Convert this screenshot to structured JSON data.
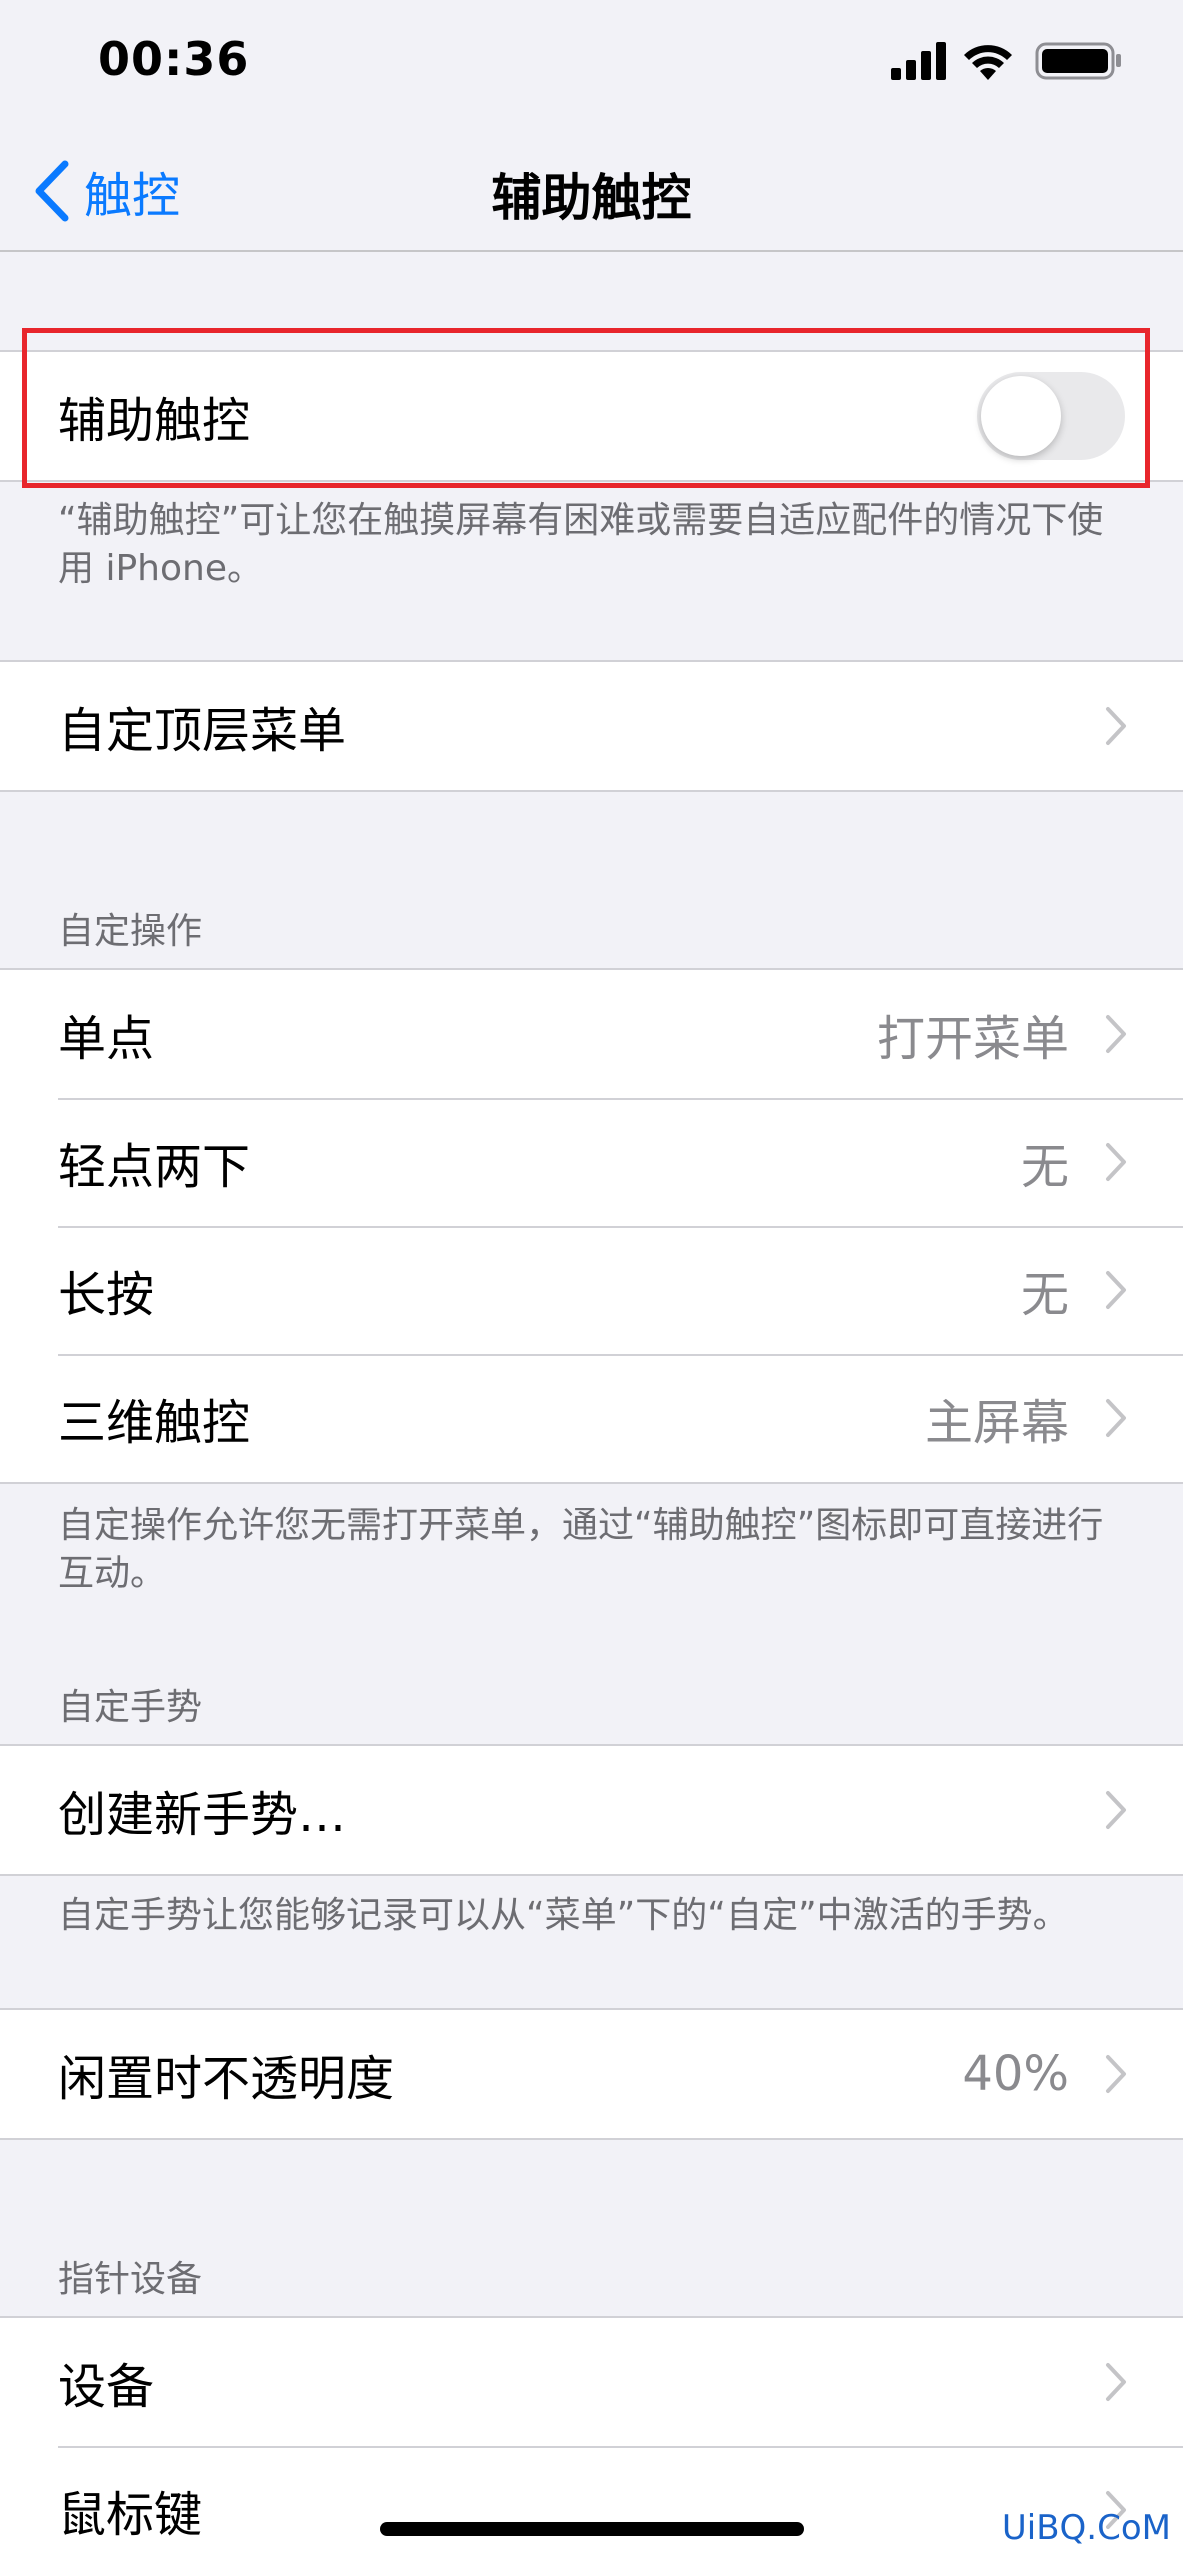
{
  "status_bar": {
    "time": "00:36"
  },
  "nav": {
    "back_label": "触控",
    "title": "辅助触控"
  },
  "assistive_touch": {
    "label": "辅助触控",
    "enabled": false,
    "footer": "“辅助触控”可让您在触摸屏幕有困难或需要自适应配件的情况下使用 iPhone。"
  },
  "top_menu": {
    "label": "自定顶层菜单"
  },
  "custom_actions": {
    "header": "自定操作",
    "items": [
      {
        "label": "单点",
        "value": "打开菜单"
      },
      {
        "label": "轻点两下",
        "value": "无"
      },
      {
        "label": "长按",
        "value": "无"
      },
      {
        "label": "三维触控",
        "value": "主屏幕"
      }
    ],
    "footer": "自定操作允许您无需打开菜单，通过“辅助触控”图标即可直接进行互动。"
  },
  "custom_gestures": {
    "header": "自定手势",
    "create_label": "创建新手势…",
    "footer": "自定手势让您能够记录可以从“菜单”下的“自定”中激活的手势。"
  },
  "idle_opacity": {
    "label": "闲置时不透明度",
    "value": "40%"
  },
  "pointer_devices": {
    "header": "指针设备",
    "items": [
      {
        "label": "设备"
      },
      {
        "label": "鼠标键"
      }
    ]
  },
  "watermark": "UiBQ.CoM",
  "colors": {
    "accent": "#0a7aff",
    "highlight": "#e8262c",
    "background": "#f2f2f7"
  }
}
